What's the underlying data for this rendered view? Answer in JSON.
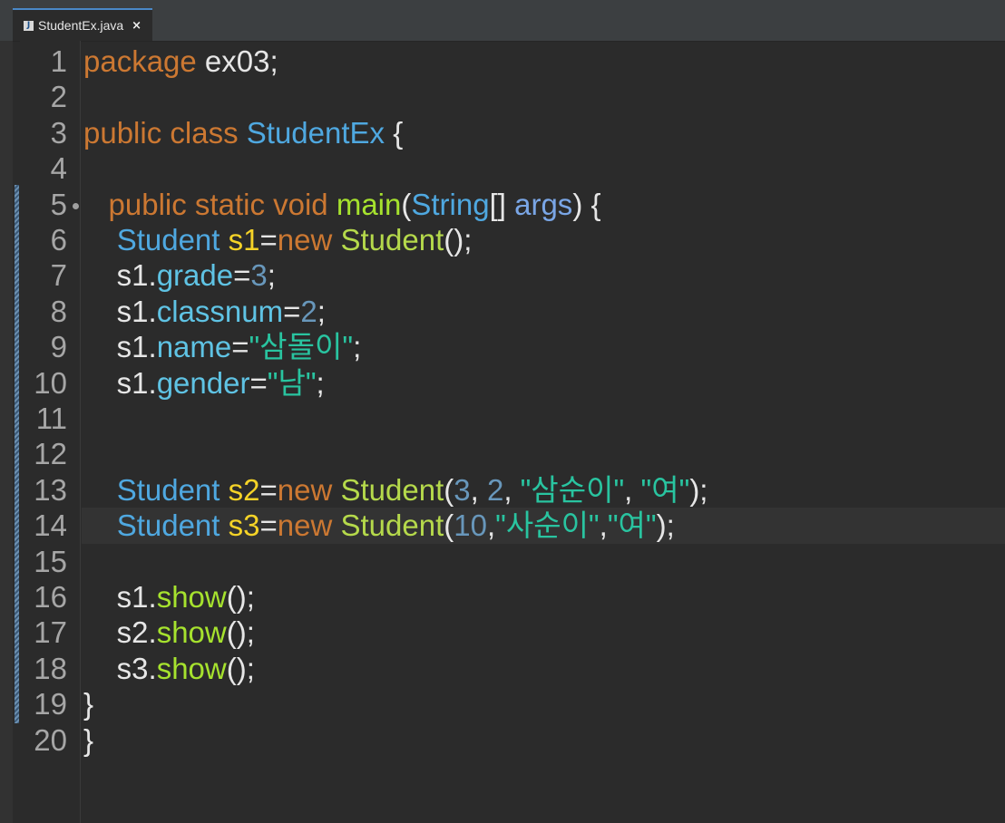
{
  "editor": {
    "tab": {
      "label": "StudentEx.java",
      "icon": "java-file-icon",
      "close": "×"
    },
    "lines": [
      {
        "n": "1",
        "tokens": [
          {
            "t": "package",
            "c": "kw"
          },
          {
            "t": " ex03;",
            "c": "pl"
          }
        ]
      },
      {
        "n": "2",
        "tokens": []
      },
      {
        "n": "3",
        "tokens": [
          {
            "t": "public",
            "c": "kw"
          },
          {
            "t": " ",
            "c": "pl"
          },
          {
            "t": "class",
            "c": "kw"
          },
          {
            "t": " ",
            "c": "pl"
          },
          {
            "t": "StudentEx",
            "c": "ty"
          },
          {
            "t": " {",
            "c": "pl"
          }
        ]
      },
      {
        "n": "4",
        "tokens": []
      },
      {
        "n": "5",
        "fold": true,
        "tokens": [
          {
            "t": "   ",
            "c": "pl"
          },
          {
            "t": "public",
            "c": "kw"
          },
          {
            "t": " ",
            "c": "pl"
          },
          {
            "t": "static",
            "c": "kw"
          },
          {
            "t": " ",
            "c": "pl"
          },
          {
            "t": "void",
            "c": "kw"
          },
          {
            "t": " ",
            "c": "pl"
          },
          {
            "t": "main",
            "c": "fn"
          },
          {
            "t": "(",
            "c": "pl"
          },
          {
            "t": "String",
            "c": "ty"
          },
          {
            "t": "[] ",
            "c": "pl"
          },
          {
            "t": "args",
            "c": "arg"
          },
          {
            "t": ") {",
            "c": "pl"
          }
        ]
      },
      {
        "n": "6",
        "tokens": [
          {
            "t": "    ",
            "c": "pl"
          },
          {
            "t": "Student",
            "c": "ty"
          },
          {
            "t": " ",
            "c": "pl"
          },
          {
            "t": "s1",
            "c": "vr"
          },
          {
            "t": "=",
            "c": "pl"
          },
          {
            "t": "new",
            "c": "kw"
          },
          {
            "t": " ",
            "c": "pl"
          },
          {
            "t": "Student",
            "c": "cls"
          },
          {
            "t": "();",
            "c": "pl"
          }
        ]
      },
      {
        "n": "7",
        "tokens": [
          {
            "t": "    s1.",
            "c": "pl"
          },
          {
            "t": "grade",
            "c": "field"
          },
          {
            "t": "=",
            "c": "pl"
          },
          {
            "t": "3",
            "c": "num"
          },
          {
            "t": ";",
            "c": "pl"
          }
        ]
      },
      {
        "n": "8",
        "tokens": [
          {
            "t": "    s1.",
            "c": "pl"
          },
          {
            "t": "classnum",
            "c": "field"
          },
          {
            "t": "=",
            "c": "pl"
          },
          {
            "t": "2",
            "c": "num"
          },
          {
            "t": ";",
            "c": "pl"
          }
        ]
      },
      {
        "n": "9",
        "tokens": [
          {
            "t": "    s1.",
            "c": "pl"
          },
          {
            "t": "name",
            "c": "field"
          },
          {
            "t": "=",
            "c": "pl"
          },
          {
            "t": "\"삼돌이\"",
            "c": "str"
          },
          {
            "t": ";",
            "c": "pl"
          }
        ]
      },
      {
        "n": "10",
        "tokens": [
          {
            "t": "    s1.",
            "c": "pl"
          },
          {
            "t": "gender",
            "c": "field"
          },
          {
            "t": "=",
            "c": "pl"
          },
          {
            "t": "\"남\"",
            "c": "str"
          },
          {
            "t": ";",
            "c": "pl"
          }
        ]
      },
      {
        "n": "11",
        "tokens": []
      },
      {
        "n": "12",
        "tokens": []
      },
      {
        "n": "13",
        "tokens": [
          {
            "t": "    ",
            "c": "pl"
          },
          {
            "t": "Student",
            "c": "ty"
          },
          {
            "t": " ",
            "c": "pl"
          },
          {
            "t": "s2",
            "c": "vr"
          },
          {
            "t": "=",
            "c": "pl"
          },
          {
            "t": "new",
            "c": "kw"
          },
          {
            "t": " ",
            "c": "pl"
          },
          {
            "t": "Student",
            "c": "cls"
          },
          {
            "t": "(",
            "c": "pl"
          },
          {
            "t": "3",
            "c": "num"
          },
          {
            "t": ", ",
            "c": "pl"
          },
          {
            "t": "2",
            "c": "num"
          },
          {
            "t": ", ",
            "c": "pl"
          },
          {
            "t": "\"삼순이\"",
            "c": "str"
          },
          {
            "t": ", ",
            "c": "pl"
          },
          {
            "t": "\"여\"",
            "c": "str"
          },
          {
            "t": ");",
            "c": "pl"
          }
        ]
      },
      {
        "n": "14",
        "current": true,
        "tokens": [
          {
            "t": "    ",
            "c": "pl"
          },
          {
            "t": "Student",
            "c": "ty"
          },
          {
            "t": " ",
            "c": "pl"
          },
          {
            "t": "s3",
            "c": "vr"
          },
          {
            "t": "=",
            "c": "pl"
          },
          {
            "t": "new",
            "c": "kw"
          },
          {
            "t": " ",
            "c": "pl"
          },
          {
            "t": "Student",
            "c": "cls"
          },
          {
            "t": "(",
            "c": "pl"
          },
          {
            "t": "10",
            "c": "num"
          },
          {
            "t": ",",
            "c": "pl"
          },
          {
            "t": "\"사순이\"",
            "c": "str"
          },
          {
            "t": ",",
            "c": "pl"
          },
          {
            "t": "\"여\"",
            "c": "str"
          },
          {
            "t": ");",
            "c": "pl"
          }
        ]
      },
      {
        "n": "15",
        "tokens": []
      },
      {
        "n": "16",
        "tokens": [
          {
            "t": "    s1.",
            "c": "pl"
          },
          {
            "t": "show",
            "c": "mth"
          },
          {
            "t": "();",
            "c": "pl"
          }
        ]
      },
      {
        "n": "17",
        "tokens": [
          {
            "t": "    s2.",
            "c": "pl"
          },
          {
            "t": "show",
            "c": "mth"
          },
          {
            "t": "();",
            "c": "pl"
          }
        ]
      },
      {
        "n": "18",
        "tokens": [
          {
            "t": "    s3.",
            "c": "pl"
          },
          {
            "t": "show",
            "c": "mth"
          },
          {
            "t": "();",
            "c": "pl"
          }
        ]
      },
      {
        "n": "19",
        "tokens": [
          {
            "t": "}",
            "c": "pl"
          }
        ]
      },
      {
        "n": "20",
        "tokens": [
          {
            "t": "}",
            "c": "pl"
          }
        ]
      }
    ]
  },
  "colors": {
    "background": "#2b2b2b",
    "keyword": "#cc7832",
    "type": "#4fa8e0",
    "variable": "#f5d327",
    "string": "#29c4a0",
    "number": "#6897bb",
    "method": "#a6e22e"
  }
}
